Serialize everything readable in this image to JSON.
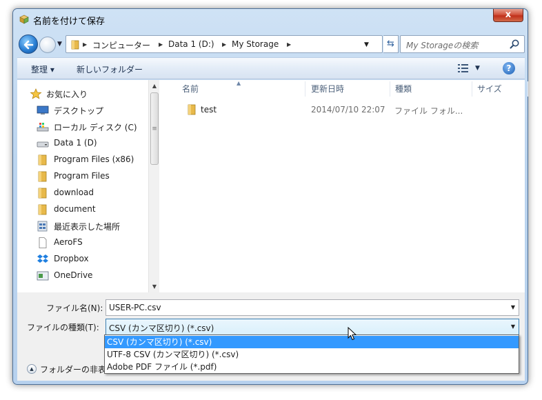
{
  "window": {
    "title": "名前を付けて保存",
    "close_label": "x"
  },
  "address": {
    "crumbs": [
      "コンピューター",
      "Data 1 (D:)",
      "My Storage"
    ],
    "search_placeholder": "My Storageの検索"
  },
  "toolbar": {
    "organize_label": "整理 ▾",
    "new_folder_label": "新しいフォルダー"
  },
  "nav": {
    "favorites_label": "お気に入り",
    "items": [
      {
        "label": "デスクトップ",
        "icon": "desktop-icon"
      },
      {
        "label": "ローカル ディスク (C)",
        "icon": "local-disk-icon"
      },
      {
        "label": "Data 1 (D)",
        "icon": "drive-icon"
      },
      {
        "label": "Program Files (x86)",
        "icon": "folder-icon"
      },
      {
        "label": "Program Files",
        "icon": "folder-icon"
      },
      {
        "label": "download",
        "icon": "folder-icon"
      },
      {
        "label": "document",
        "icon": "folder-icon"
      },
      {
        "label": "最近表示した場所",
        "icon": "recent-places-icon"
      },
      {
        "label": "AeroFS",
        "icon": "document-icon"
      },
      {
        "label": "Dropbox",
        "icon": "dropbox-icon"
      },
      {
        "label": "OneDrive",
        "icon": "onedrive-icon"
      }
    ]
  },
  "files": {
    "columns": [
      "名前",
      "更新日時",
      "種類",
      "サイズ"
    ],
    "rows": [
      {
        "name": "test",
        "modified": "2014/07/10 22:07",
        "type": "ファイル フォル...",
        "size": ""
      }
    ]
  },
  "save": {
    "filename_label": "ファイル名(N):",
    "filename_value": "USER-PC.csv",
    "filetype_label": "ファイルの種類(T):",
    "filetype_value": "CSV (カンマ区切り) (*.csv)",
    "filetype_options": [
      "CSV (カンマ区切り) (*.csv)",
      "UTF-8 CSV (カンマ区切り) (*.csv)",
      "Adobe PDF ファイル (*.pdf)"
    ],
    "hide_folders_label": "フォルダーの非表"
  },
  "colors": {
    "selection": "#3399ff",
    "folder": "#e8b94a"
  }
}
